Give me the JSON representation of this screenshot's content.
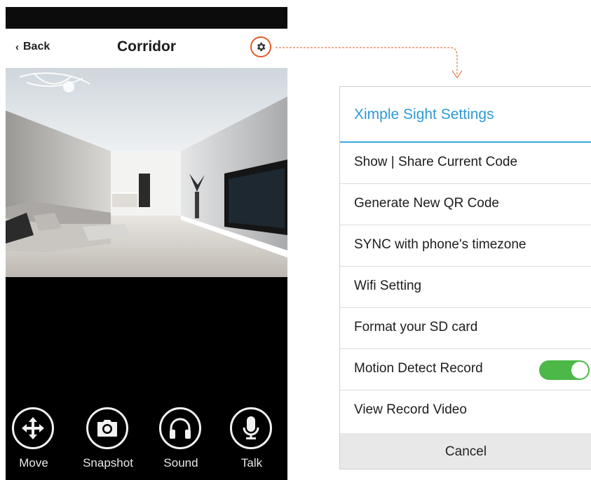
{
  "phone": {
    "nav": {
      "back_label": "Back",
      "title": "Corridor"
    },
    "video": {
      "description_icon": "camera-feed"
    },
    "controls": [
      {
        "label": "Move",
        "icon": "move-arrows-icon"
      },
      {
        "label": "Snapshot",
        "icon": "camera-icon"
      },
      {
        "label": "Sound",
        "icon": "headphones-icon"
      },
      {
        "label": "Talk",
        "icon": "microphone-icon"
      }
    ]
  },
  "settings_menu": {
    "title": "Ximple Sight Settings",
    "items": [
      {
        "label": "Show | Share Current Code"
      },
      {
        "label": "Generate New QR Code"
      },
      {
        "label": "SYNC with phone's timezone"
      },
      {
        "label": "Wifi Setting"
      },
      {
        "label": "Format your SD card"
      },
      {
        "label": "Motion Detect Record",
        "toggle": true,
        "toggle_on": true
      },
      {
        "label": "View Record Video"
      }
    ],
    "cancel_label": "Cancel"
  },
  "colors": {
    "accent_blue": "#2e9ad6",
    "toggle_green": "#4cb848",
    "highlight_orange": "#e05a2a"
  }
}
